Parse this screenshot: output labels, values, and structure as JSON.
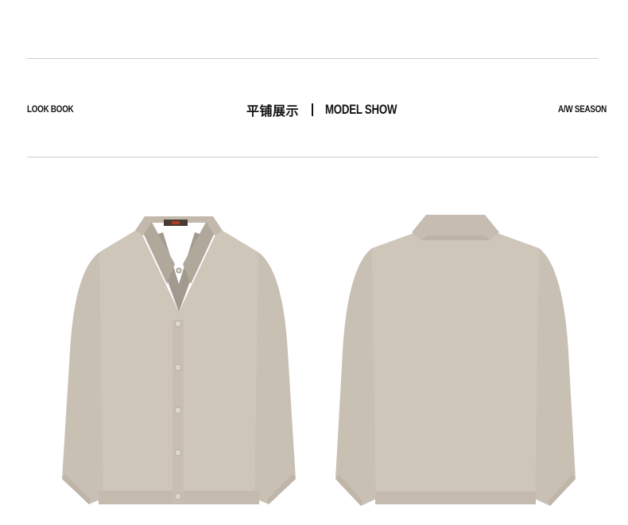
{
  "header": {
    "left_label": "LOOK BOOK",
    "center_cn": "平铺展示",
    "center_en": "MODEL SHOW",
    "right_label": "A/W SEASON"
  },
  "colors": {
    "knit": "#cdc4b8",
    "knit_shade": "#bdb3a6",
    "collar_shirt": "#9a9187",
    "rule": "#cfcfcf"
  },
  "garments": [
    {
      "view": "front",
      "icon": "cardigan-front-image"
    },
    {
      "view": "back",
      "icon": "cardigan-back-image"
    }
  ]
}
